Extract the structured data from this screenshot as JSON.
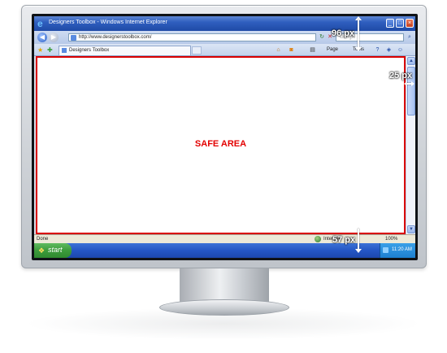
{
  "browser": {
    "title": "Designers Toolbox - Windows Internet Explorer",
    "address": "http://www.designerstoolbox.com/",
    "search_placeholder": "Google",
    "tab_label": "Designers Toolbox",
    "commands": {
      "page": "Page",
      "tools": "Tools"
    },
    "status_left": "Done",
    "zone": "Internet",
    "zoom": "100%"
  },
  "content": {
    "label": "SAFE AREA"
  },
  "taskbar": {
    "start_label": "start",
    "clock": "11:20 AM"
  },
  "annotations": {
    "top": "96 px",
    "right": "25 px",
    "bottom": "57 px"
  },
  "colors": {
    "safe_border": "#d90000",
    "safe_label": "#e30000",
    "titlebar": "#2f5fbf",
    "taskbar": "#2456c4",
    "start": "#3c9b3c"
  },
  "icons": [
    "ie-logo-icon",
    "back-icon",
    "forward-icon",
    "refresh-icon",
    "stop-icon",
    "search-icon",
    "favorites-star-icon",
    "add-favorite-icon",
    "home-icon",
    "feeds-icon",
    "print-icon",
    "help-icon",
    "windows-flag-icon"
  ]
}
